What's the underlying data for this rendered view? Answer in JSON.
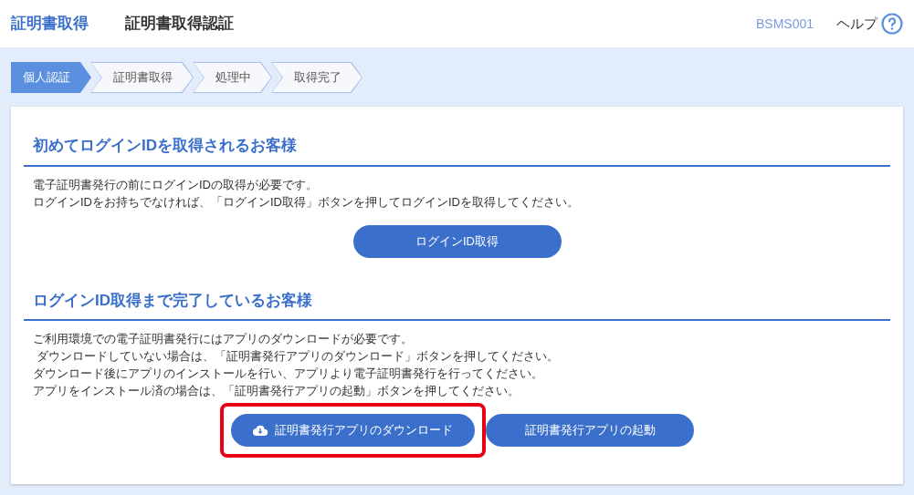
{
  "header": {
    "app_title": "証明書取得",
    "page_title": "証明書取得認証",
    "screen_id": "BSMS001",
    "help": "ヘルプ"
  },
  "steps": [
    {
      "label": "個人認証",
      "selected": true
    },
    {
      "label": "証明書取得",
      "selected": false
    },
    {
      "label": "処理中",
      "selected": false
    },
    {
      "label": "取得完了",
      "selected": false
    }
  ],
  "sections": [
    {
      "heading": "初めてログインIDを取得されるお客様",
      "lines": [
        "電子証明書発行の前にログインIDの取得が必要です。",
        "ログインIDをお持ちでなければ、「ログインID取得」ボタンを押してログインIDを取得してください。"
      ],
      "buttons": [
        {
          "label": "ログインID取得",
          "kind": "plain",
          "highlighted": false
        }
      ]
    },
    {
      "heading": "ログインID取得まで完了しているお客様",
      "lines": [
        "ご利用環境での電子証明書発行にはアプリのダウンロードが必要です。",
        " ダウンロードしていない場合は、「証明書発行アプリのダウンロード」ボタンを押してください。",
        "ダウンロード後にアプリのインストールを行い、アプリより電子証明書発行を行ってください。",
        "アプリをインストール済の場合は、「証明書発行アプリの起動」ボタンを押してください。"
      ],
      "buttons": [
        {
          "label": "証明書発行アプリのダウンロード",
          "kind": "download",
          "highlighted": true
        },
        {
          "label": "証明書発行アプリの起動",
          "kind": "plain",
          "highlighted": false
        }
      ]
    }
  ]
}
